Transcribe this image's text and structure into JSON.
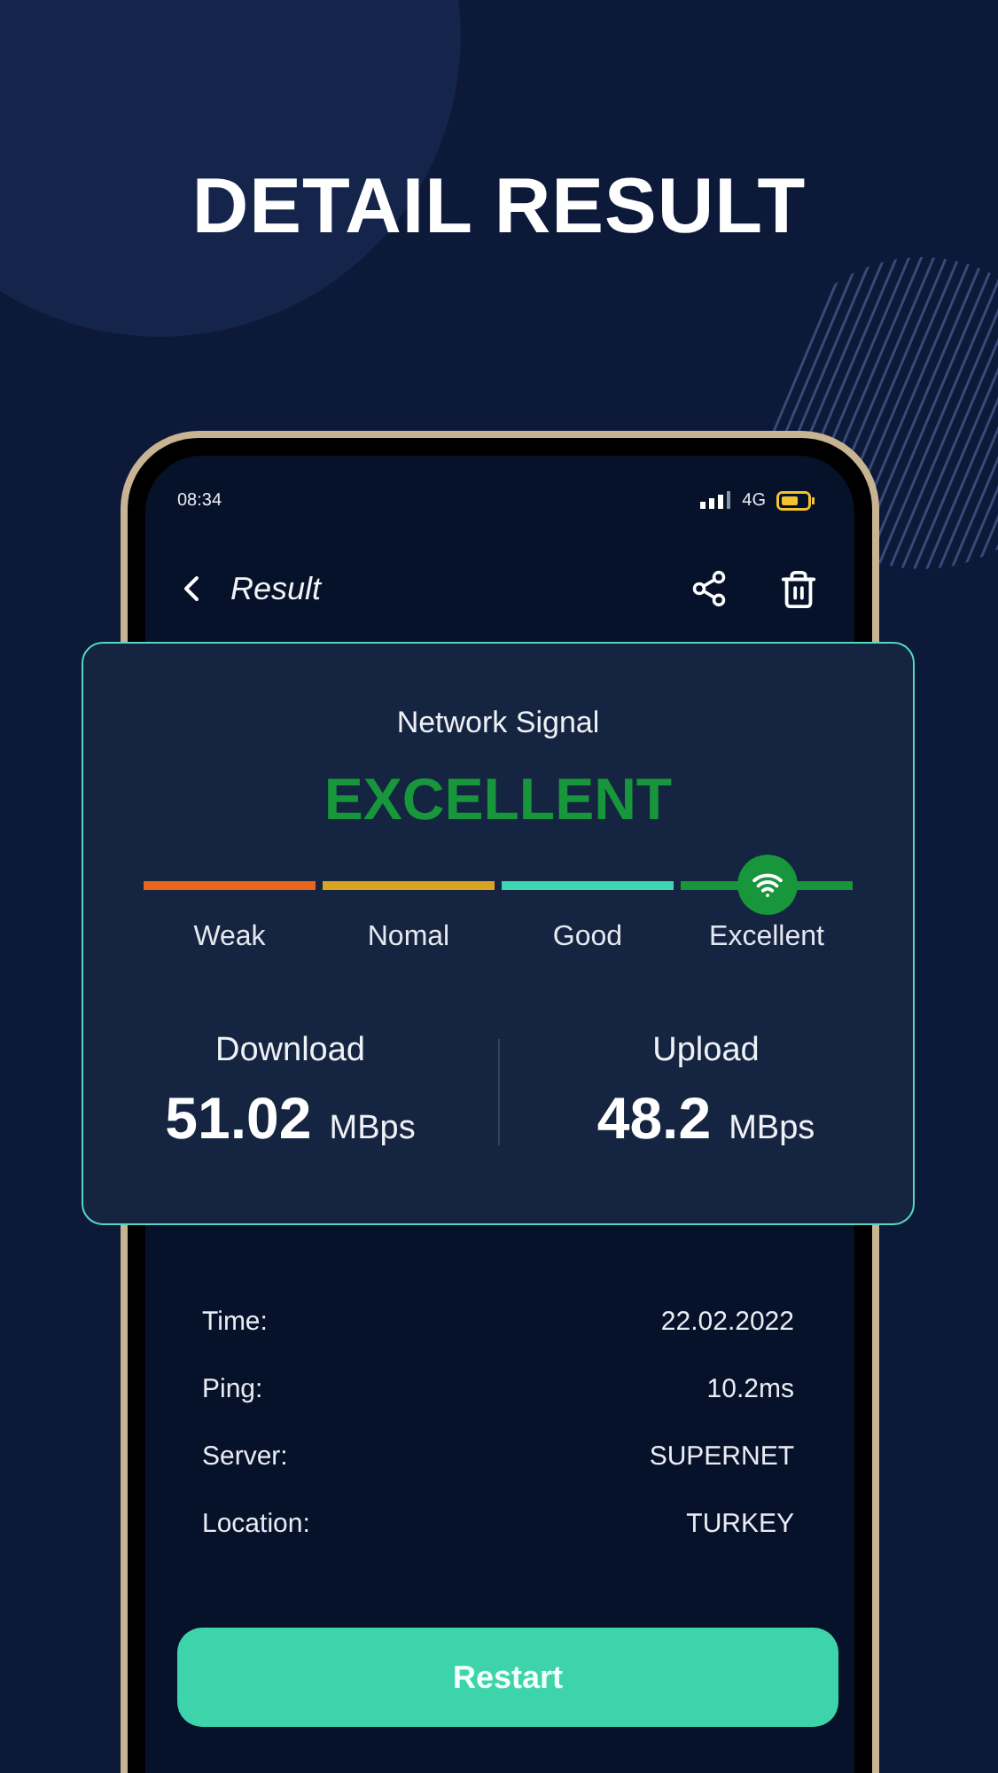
{
  "headline": "DETAIL RESULT",
  "status_bar": {
    "time": "08:34",
    "network": "4G"
  },
  "header": {
    "title": "Result"
  },
  "card": {
    "heading": "Network Signal",
    "rating": "EXCELLENT",
    "scale": [
      {
        "label": "Weak",
        "color": "#e8661e",
        "selected": false
      },
      {
        "label": "Nomal",
        "color": "#d9a521",
        "selected": false
      },
      {
        "label": "Good",
        "color": "#3ed6b0",
        "selected": false
      },
      {
        "label": "Excellent",
        "color": "#17963b",
        "selected": true
      }
    ],
    "download": {
      "label": "Download",
      "value": "51.02",
      "unit": "MBps"
    },
    "upload": {
      "label": "Upload",
      "value": "48.2",
      "unit": "MBps"
    }
  },
  "details": [
    {
      "label": "Time:",
      "value": "22.02.2022"
    },
    {
      "label": "Ping:",
      "value": "10.2ms"
    },
    {
      "label": "Server:",
      "value": "SUPERNET"
    },
    {
      "label": "Location:",
      "value": "TURKEY"
    }
  ],
  "button": "Restart"
}
